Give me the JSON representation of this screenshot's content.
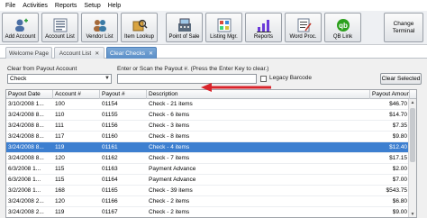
{
  "menu": [
    "File",
    "Activities",
    "Reports",
    "Setup",
    "Help"
  ],
  "toolbar": {
    "buttons": [
      {
        "label": "Add Account",
        "icon": "add-account-icon"
      },
      {
        "label": "Account List",
        "icon": "account-list-icon"
      },
      {
        "label": "Vendor List",
        "icon": "vendor-list-icon"
      },
      {
        "label": "Item Lookup",
        "icon": "item-lookup-icon"
      },
      {
        "label": "Point of Sale",
        "icon": "point-of-sale-icon"
      },
      {
        "label": "Listing Mgr.",
        "icon": "listing-manager-icon"
      },
      {
        "label": "Reports",
        "icon": "reports-icon"
      },
      {
        "label": "Word Proc.",
        "icon": "word-processor-icon"
      },
      {
        "label": "QB Link",
        "icon": "qb-link-icon"
      }
    ],
    "change_terminal": "Change Terminal"
  },
  "tabs": [
    {
      "label": "Welcome Page",
      "active": false
    },
    {
      "label": "Account List",
      "active": false
    },
    {
      "label": "Clear Checks",
      "active": true
    }
  ],
  "filters": {
    "clear_from_label": "Clear from Payout Account",
    "clear_from_value": "Check",
    "payout_label": "Enter or Scan the Payout #.  (Press the Enter Key to clear.)",
    "payout_value": "",
    "legacy_label": "Legacy Barcode",
    "legacy_checked": false,
    "clear_selected": "Clear Selected"
  },
  "grid": {
    "columns": [
      "Payout Date",
      "Account #",
      "Payout #",
      "Description",
      "Payout Amount"
    ],
    "rows": [
      {
        "date": "3/10/2008 1...",
        "account": "100",
        "payout": "01154",
        "description": "Check - 21 items",
        "amount": "$46.70",
        "selected": false
      },
      {
        "date": "3/24/2008 8...",
        "account": "110",
        "payout": "01155",
        "description": "Check - 6 items",
        "amount": "$14.70",
        "selected": false
      },
      {
        "date": "3/24/2008 8...",
        "account": "111",
        "payout": "01156",
        "description": "Check - 3 items",
        "amount": "$7.35",
        "selected": false
      },
      {
        "date": "3/24/2008 8...",
        "account": "117",
        "payout": "01160",
        "description": "Check - 8 items",
        "amount": "$9.80",
        "selected": false
      },
      {
        "date": "3/24/2008 8...",
        "account": "119",
        "payout": "01161",
        "description": "Check - 4 items",
        "amount": "$12.40",
        "selected": true
      },
      {
        "date": "3/24/2008 8...",
        "account": "120",
        "payout": "01162",
        "description": "Check - 7 items",
        "amount": "$17.15",
        "selected": false
      },
      {
        "date": "6/3/2008 1...",
        "account": "115",
        "payout": "01163",
        "description": "Payment Advance",
        "amount": "$2.00",
        "selected": false
      },
      {
        "date": "6/3/2008 1...",
        "account": "115",
        "payout": "01164",
        "description": "Payment Advance",
        "amount": "$7.00",
        "selected": false
      },
      {
        "date": "3/2/2008 1...",
        "account": "168",
        "payout": "01165",
        "description": "Check - 39 items",
        "amount": "$543.75",
        "selected": false
      },
      {
        "date": "3/24/2008 2...",
        "account": "120",
        "payout": "01166",
        "description": "Check - 2 items",
        "amount": "$6.80",
        "selected": false
      },
      {
        "date": "3/24/2008 2...",
        "account": "119",
        "payout": "01167",
        "description": "Check - 2 items",
        "amount": "$9.00",
        "selected": false
      }
    ]
  },
  "colors": {
    "selection": "#3d7fd0",
    "annotation_arrow": "#d9242b",
    "active_tab": "#5b8fc8"
  }
}
